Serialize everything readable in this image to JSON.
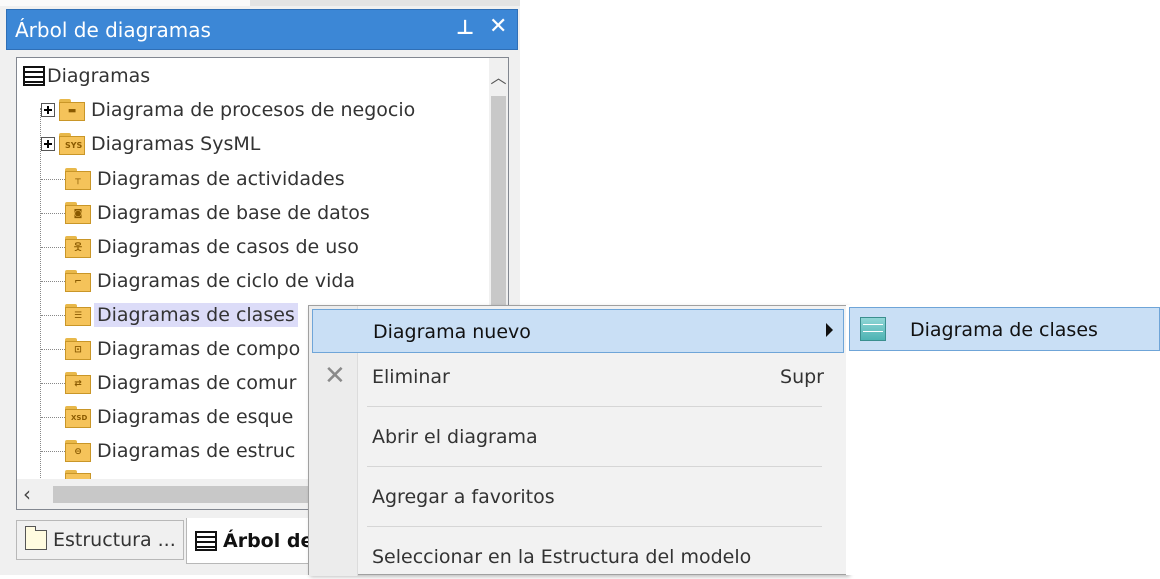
{
  "panel": {
    "title": "Árbol de diagramas",
    "pin_icon": "pin-icon",
    "close_icon": "close-icon"
  },
  "tree": {
    "root": {
      "label": "Diagramas",
      "icon": "diagram-list-icon"
    },
    "items": [
      {
        "label": "Diagrama de procesos de negocio",
        "expandable": true,
        "icon": "folder-business-process-icon",
        "glyph": "▬"
      },
      {
        "label": "Diagramas SysML",
        "expandable": true,
        "icon": "folder-sysml-icon",
        "glyph": "SYS"
      },
      {
        "label": "Diagramas de actividades",
        "expandable": false,
        "icon": "folder-activity-icon",
        "glyph": "┬"
      },
      {
        "label": "Diagramas de base de datos",
        "expandable": false,
        "icon": "folder-database-icon",
        "glyph": "◙"
      },
      {
        "label": "Diagramas de casos de uso",
        "expandable": false,
        "icon": "folder-use-case-icon",
        "glyph": "웃"
      },
      {
        "label": "Diagramas de ciclo de vida",
        "expandable": false,
        "icon": "folder-lifecycle-icon",
        "glyph": "⌐"
      },
      {
        "label": "Diagramas de clases",
        "expandable": false,
        "icon": "folder-class-icon",
        "glyph": "☰",
        "selected": true
      },
      {
        "label": "Diagramas de compo",
        "expandable": false,
        "icon": "folder-component-icon",
        "glyph": "⊡"
      },
      {
        "label": "Diagramas de comur",
        "expandable": false,
        "icon": "folder-communication-icon",
        "glyph": "⇄"
      },
      {
        "label": "Diagramas de esque",
        "expandable": false,
        "icon": "folder-xsd-icon",
        "glyph": "XSD"
      },
      {
        "label": "Diagramas de estruc",
        "expandable": false,
        "icon": "folder-structure-icon",
        "glyph": "⊖"
      }
    ]
  },
  "bottom_tabs": [
    {
      "label": "Estructura ...",
      "icon": "folder-outline-icon",
      "active": false
    },
    {
      "label": "Árbol de",
      "icon": "diagram-list-icon",
      "active": true
    }
  ],
  "context_menu": {
    "items": [
      {
        "label": "Diagrama nuevo",
        "shortcut": "",
        "has_submenu": true,
        "highlighted": true
      },
      {
        "label": "Eliminar",
        "shortcut": "Supr",
        "icon": "delete-x-icon"
      },
      {
        "label": "Abrir el diagrama",
        "shortcut": ""
      },
      {
        "label": "Agregar a favoritos",
        "shortcut": ""
      },
      {
        "label": "Seleccionar en la Estructura del modelo",
        "shortcut": ""
      }
    ]
  },
  "submenu": {
    "items": [
      {
        "label": "Diagrama de clases",
        "icon": "class-diagram-icon"
      }
    ]
  },
  "colors": {
    "titlebar": "#3c87d6",
    "highlight": "#c9dff5",
    "selection": "#dcdcf8",
    "folder": "#f5c35a"
  }
}
